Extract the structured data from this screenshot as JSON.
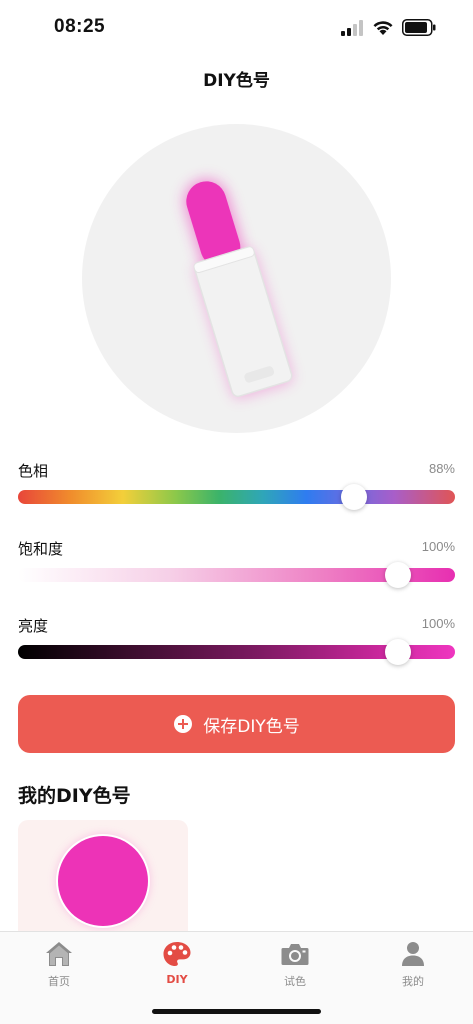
{
  "status_bar": {
    "time": "08:25"
  },
  "header": {
    "title": "DIY色号"
  },
  "preview": {
    "color": "#ec35b9",
    "icon": "lipstick-icon"
  },
  "sliders": [
    {
      "label": "色相",
      "value_text": "88%",
      "value": 0.77
    },
    {
      "label": "饱和度",
      "value_text": "100%",
      "value": 0.87
    },
    {
      "label": "亮度",
      "value_text": "100%",
      "value": 0.87
    }
  ],
  "save_button": {
    "label": "保存DIY色号",
    "icon": "plus-circle-icon",
    "color": "#ec5b52"
  },
  "my_colors": {
    "title": "我的DIY色号",
    "items": [
      {
        "color": "#ed33b7"
      }
    ]
  },
  "tab_bar": {
    "active_color": "#e34c44",
    "items": [
      {
        "label": "首页",
        "icon": "home-icon"
      },
      {
        "label": "DIY",
        "icon": "palette-icon"
      },
      {
        "label": "试色",
        "icon": "camera-icon"
      },
      {
        "label": "我的",
        "icon": "person-icon"
      }
    ]
  }
}
